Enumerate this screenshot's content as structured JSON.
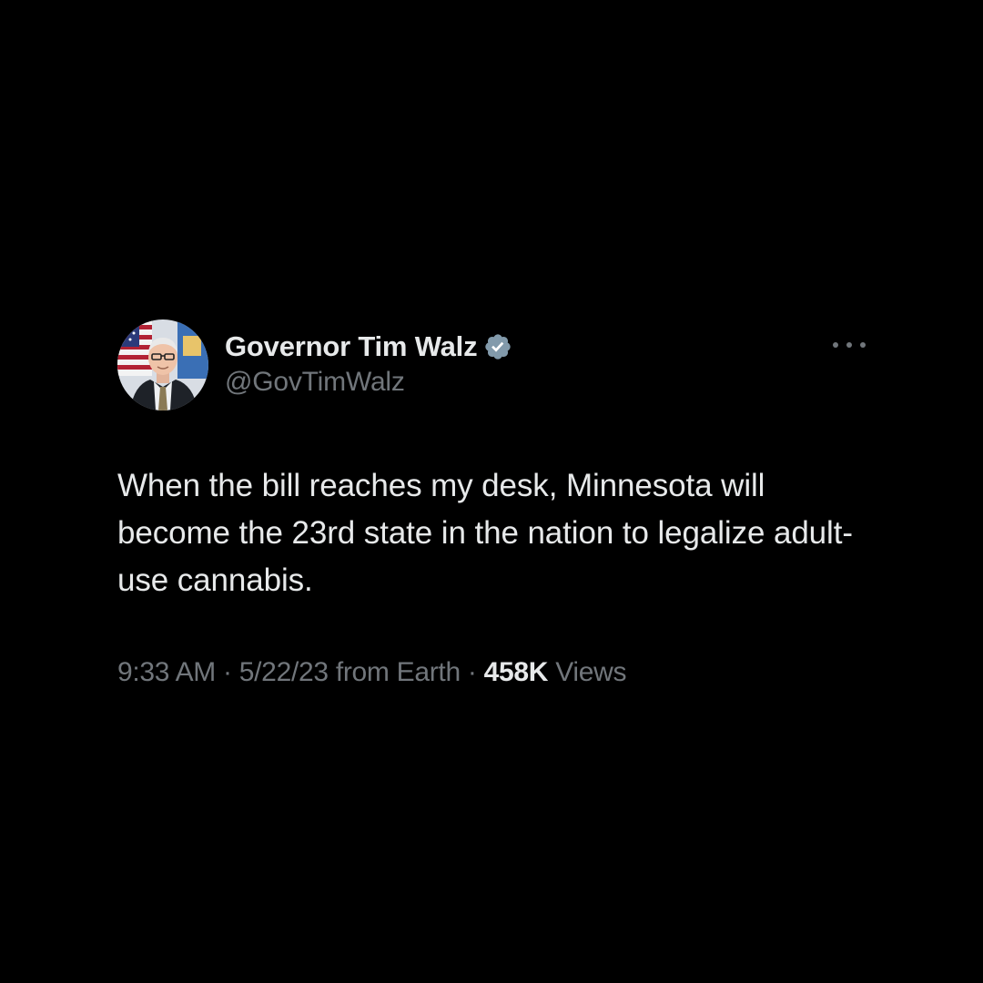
{
  "tweet": {
    "author": {
      "display_name": "Governor Tim Walz",
      "handle": "@GovTimWalz",
      "verified_icon": "verified-badge-icon",
      "avatar_icon": "avatar-photo"
    },
    "text": "When the bill reaches my desk, Minnesota will become the 23rd state in the nation to legalize adult-use cannabis.",
    "meta": {
      "time": "9:33 AM",
      "separator": "·",
      "date": "5/22/23",
      "source": "from Earth",
      "views_count": "458K",
      "views_label": "Views"
    },
    "more_icon": "more-options-icon"
  },
  "colors": {
    "background": "#000000",
    "primary_text": "#e7e9ea",
    "secondary_text": "#71767b",
    "verified_badge": "#829aab"
  }
}
